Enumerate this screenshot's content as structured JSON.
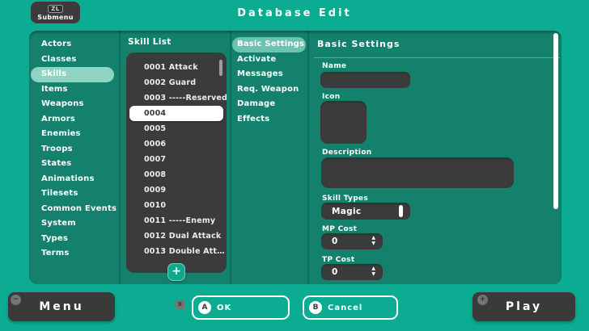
{
  "colors": {
    "background": "#0BAC91",
    "panel": "#14816C",
    "sidebar_highlight": "#8FD4C2",
    "tab_highlight": "#6CC3AF",
    "dark_ui": "#3B3B3B",
    "accent": "#0EA88C"
  },
  "top_bar": {
    "title": "Database Edit",
    "submenu_key": "ZL",
    "submenu_label": "Submenu"
  },
  "sidebar": {
    "selected": "Skills",
    "items": [
      "Actors",
      "Classes",
      "Skills",
      "Items",
      "Weapons",
      "Armors",
      "Enemies",
      "Troops",
      "States",
      "Animations",
      "Tilesets",
      "Common Events",
      "System",
      "Types",
      "Terms"
    ]
  },
  "skill_list": {
    "header": "Skill List",
    "selected": "0004",
    "items": [
      "0001 Attack",
      "0002 Guard",
      "0003 -----Reserved",
      "0004",
      "0005",
      "0006",
      "0007",
      "0008",
      "0009",
      "0010",
      "0011 -----Enemy",
      "0012 Dual Attack",
      "0013 Double Att…"
    ],
    "add_icon": "+"
  },
  "tabs": {
    "selected": "Basic Settings",
    "items": [
      "Basic Settings",
      "Activate",
      "Messages",
      "Req. Weapon",
      "Damage",
      "Effects"
    ]
  },
  "form": {
    "header": "Basic Settings",
    "name_label": "Name",
    "name_value": "",
    "icon_label": "Icon",
    "description_label": "Description",
    "description_value": "",
    "skill_types_label": "Skill Types",
    "skill_types_value": "Magic",
    "mp_cost_label": "MP Cost",
    "mp_cost_value": "0",
    "tp_cost_label": "TP Cost",
    "tp_cost_value": "0"
  },
  "icons": {
    "spinner_up": "▲",
    "spinner_down": "▼"
  },
  "bottom_bar": {
    "menu_key": "−",
    "menu_label": "Menu",
    "x_key": "X",
    "ok_key": "A",
    "ok_label": "OK",
    "cancel_key": "B",
    "cancel_label": "Cancel",
    "play_key": "+",
    "play_label": "Play"
  }
}
